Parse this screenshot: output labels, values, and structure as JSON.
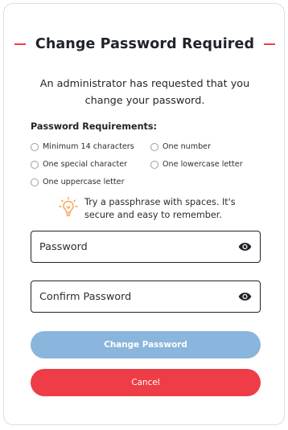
{
  "header": {
    "title": "Change Password Required",
    "accent_color": "#ef3e4a"
  },
  "message": {
    "line1": "An administrator has requested that you",
    "line2": "change your password."
  },
  "requirements": {
    "heading": "Password Requirements:",
    "items": [
      "Minimum 14 characters",
      "One number",
      "One special character",
      "One lowercase letter",
      "One uppercase letter"
    ]
  },
  "tip": {
    "icon": "lightbulb-icon",
    "icon_color": "#f59332",
    "line1": "Try a passphrase with spaces. It's",
    "line2": "secure and easy to remember."
  },
  "fields": {
    "password": {
      "placeholder": "Password",
      "value": "",
      "toggle_icon": "eye-icon"
    },
    "confirm_password": {
      "placeholder": "Confirm Password",
      "value": "",
      "toggle_icon": "eye-icon"
    }
  },
  "buttons": {
    "change_password": {
      "label": "Change Password",
      "color": "#8ab5dc",
      "state": "disabled"
    },
    "cancel": {
      "label": "Cancel",
      "color": "#ee3d47"
    }
  }
}
